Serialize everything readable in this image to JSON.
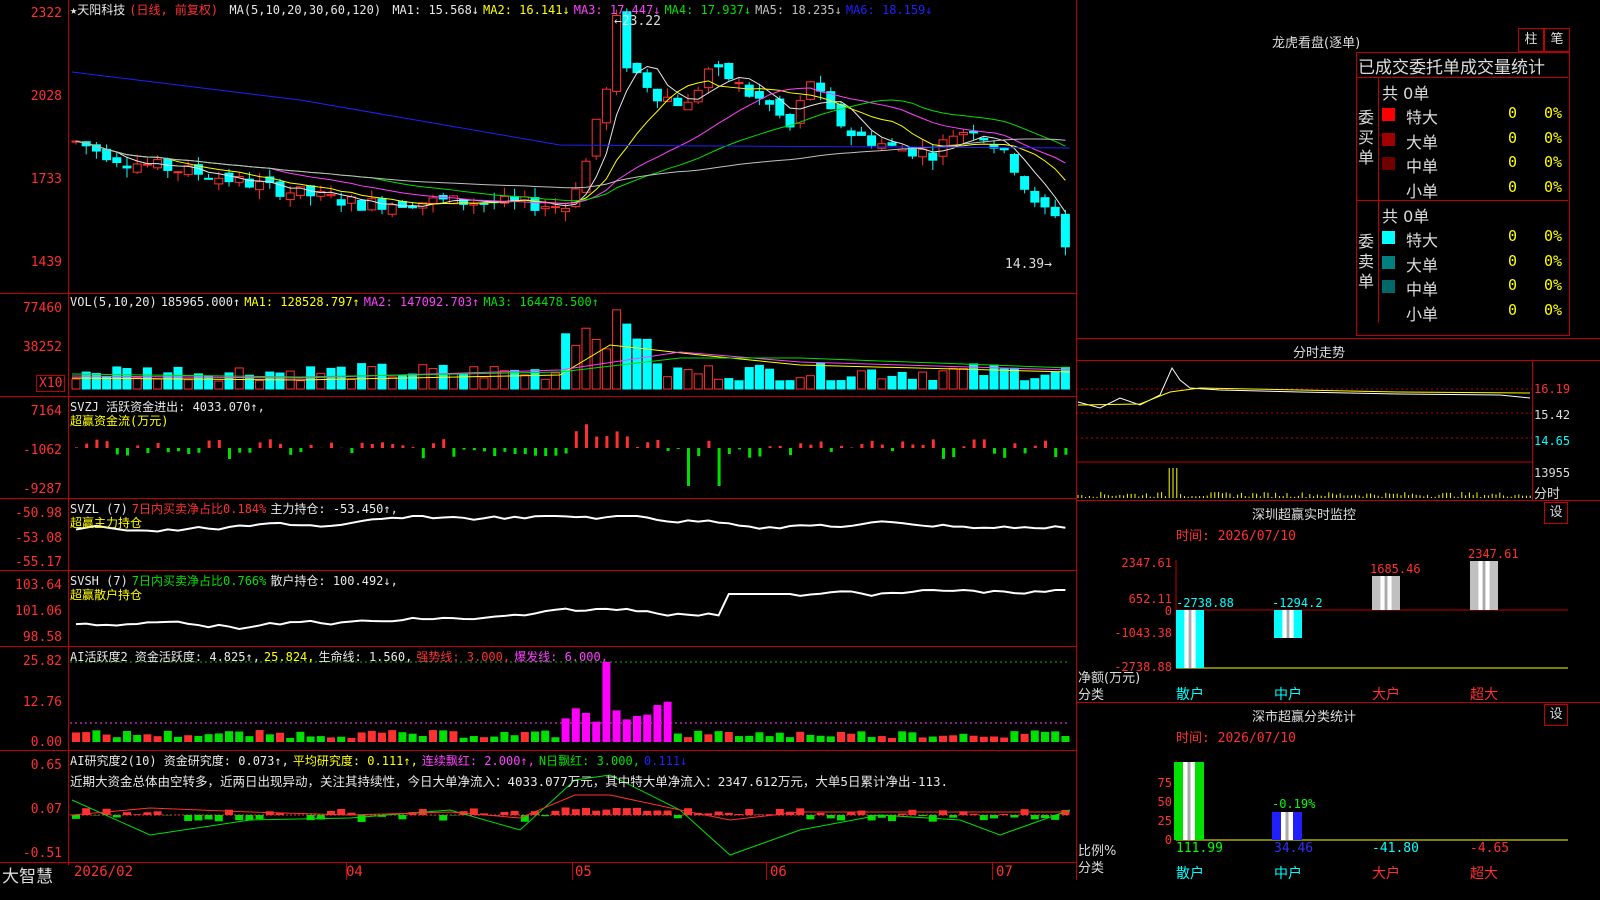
{
  "main": {
    "symbol": "★天阳科技",
    "mode": "(日线, 前复权)",
    "ma_params": "MA(5,10,20,30,60,120)",
    "ma": [
      {
        "label": "MA1:",
        "value": "15.568↓",
        "color": "#e8e8e8"
      },
      {
        "label": "MA2:",
        "value": "16.141↓",
        "color": "#ffff00"
      },
      {
        "label": "MA3:",
        "value": "17.447↓",
        "color": "#ff40ff"
      },
      {
        "label": "MA4:",
        "value": "17.937↓",
        "color": "#00e000"
      },
      {
        "label": "MA5:",
        "value": "18.235↓",
        "color": "#c0c0c0"
      },
      {
        "label": "MA6:",
        "value": "18.159↓",
        "color": "#2020ff"
      }
    ],
    "y_labels": [
      "2322",
      "2028",
      "1733",
      "1439"
    ],
    "high_marker": "←23.22",
    "low_marker": "14.39→"
  },
  "vol": {
    "title": "VOL(5,10,20)",
    "value": "185965.000↑",
    "ma1": "MA1: 128528.797↑",
    "ma2": "MA2: 147092.703↑",
    "ma3": "MA3: 164478.500↑",
    "y_labels": [
      "77460",
      "38252"
    ],
    "unit": "X10"
  },
  "svzj": {
    "title": "SVZJ  活跃资金进出: 4033.070↑,",
    "subtitle": "超赢资金流(万元)",
    "y_labels": [
      "7164",
      "-1062",
      "-9287"
    ]
  },
  "svzl": {
    "title": "SVZL (7)",
    "ratio": "7日内买卖净占比0.184%",
    "hold": "主力持仓: -53.450↑,",
    "subtitle": "超赢主力持仓",
    "y_labels": [
      "-50.98",
      "-53.08",
      "-55.17"
    ]
  },
  "svsh": {
    "title": "SVSH (7)",
    "ratio": "7日内买卖净占比0.766%",
    "hold": "散户持仓: 100.492↓,",
    "subtitle": "超赢散户持仓",
    "y_labels": [
      "103.64",
      "101.06",
      "98.58"
    ]
  },
  "ai_act": {
    "title": "AI活跃度2 资金活跃度: 4.825↑,",
    "v2": "25.824,",
    "v3": "生命线: 1.560,",
    "v4": "强势线: 3.000,",
    "v5": "爆发线: 6.000,",
    "y_labels": [
      "25.82",
      "12.76",
      "0.00"
    ]
  },
  "ai_res": {
    "title": "AI研究度2(10) 资金研究度: 0.073↑,",
    "v2": "平均研究度: 0.111↑,",
    "v3": "连续飘红: 2.000↑,",
    "v4": "N日飘红: 3.000,",
    "v5": "0.111↓",
    "comment": "近期大资金总体由空转多，近两日出现异动，关注其持续性，今日大单净流入：4033.077万元，其中特大单净流入：2347.612万元，大单5日累计净出-113.",
    "y_labels": [
      "0.65",
      "0.07",
      "-0.51"
    ]
  },
  "xaxis": {
    "brand": "大智慧",
    "labels": [
      "2026/02",
      "04",
      "05",
      "06",
      "07"
    ]
  },
  "lhb": {
    "title": "龙虎看盘(逐单)",
    "btn1": "柱",
    "btn2": "笔",
    "header": "已成交委托单成交量统计",
    "buy_label": "委买单",
    "sell_label": "委卖单",
    "buy_total": "共 0单",
    "sell_total": "共 0单",
    "buy_rows": [
      {
        "name": "特大",
        "count": "0",
        "pct": "0%",
        "color": "#ff0000"
      },
      {
        "name": "大单",
        "count": "0",
        "pct": "0%",
        "color": "#a00000"
      },
      {
        "name": "中单",
        "count": "0",
        "pct": "0%",
        "color": "#700000"
      },
      {
        "name": "小单",
        "count": "0",
        "pct": "0%",
        "color": "#000000"
      }
    ],
    "sell_rows": [
      {
        "name": "特大",
        "count": "0",
        "pct": "0%",
        "color": "#00ffff"
      },
      {
        "name": "大单",
        "count": "0",
        "pct": "0%",
        "color": "#008080"
      },
      {
        "name": "中单",
        "count": "0",
        "pct": "0%",
        "color": "#006868"
      },
      {
        "name": "小单",
        "count": "0",
        "pct": "0%",
        "color": "#000000"
      }
    ]
  },
  "intraday": {
    "title": "分时走势",
    "y_labels": [
      "16.19",
      "15.42",
      "14.65",
      "13955"
    ],
    "bottom_label": "分时"
  },
  "monitor": {
    "title": "深圳超赢实时监控",
    "setting": "设",
    "time": "时间: 2026/07/10",
    "y_labels": [
      "2347.61",
      "652.11",
      "0",
      "-1043.38",
      "-2738.88"
    ],
    "unit": "净额(万元)",
    "cat_label": "分类",
    "categories": [
      "散户",
      "中户",
      "大户",
      "超大"
    ],
    "values": [
      "-2738.88",
      "-1294.2",
      "1685.46",
      "2347.61"
    ]
  },
  "classify": {
    "title": "深市超赢分类统计",
    "setting": "设",
    "time": "时间: 2026/07/10",
    "y_labels": [
      "75",
      "50",
      "25",
      "0"
    ],
    "unit": "比例%",
    "cat_label": "分类",
    "categories": [
      "散户",
      "中户",
      "大户",
      "超大"
    ],
    "values": [
      "111.99",
      "34.46",
      "-41.80",
      "-4.65"
    ],
    "mid_label": "-0.19%"
  }
}
